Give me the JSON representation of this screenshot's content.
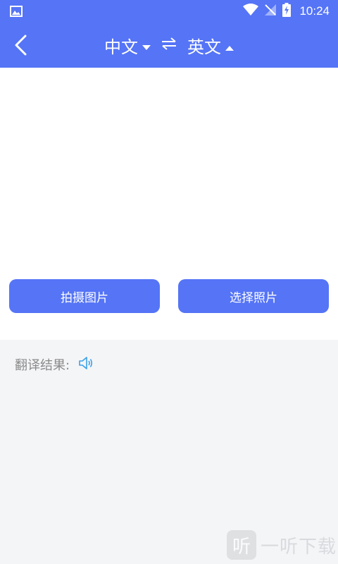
{
  "status_bar": {
    "time": "10:24",
    "icons": [
      "image-icon",
      "wifi-icon",
      "signal-off-icon",
      "battery-charging-icon"
    ]
  },
  "header": {
    "back_icon": "chevron-left-icon",
    "source_language": "中文",
    "target_language": "英文",
    "swap_icon": "swap-arrows-icon"
  },
  "actions": {
    "take_photo_label": "拍摄图片",
    "choose_photo_label": "选择照片"
  },
  "result": {
    "label": "翻译结果:",
    "speaker_icon": "speaker-icon"
  },
  "watermark": {
    "logo_char": "听",
    "text": "一听下载"
  },
  "colors": {
    "primary": "#5574f6",
    "result_background": "#f4f5f7",
    "label_gray": "#8a8a8a",
    "speaker_blue": "#3aa0e8"
  }
}
